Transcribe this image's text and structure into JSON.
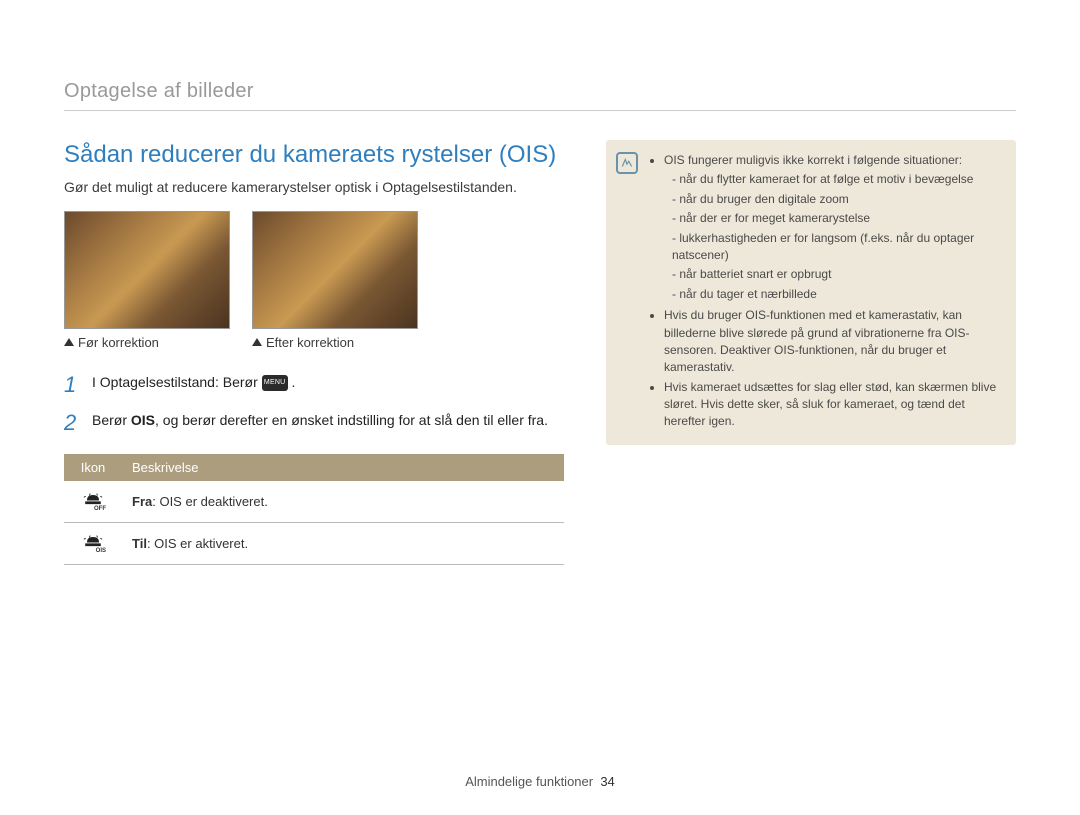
{
  "breadcrumb": "Optagelse af billeder",
  "title": "Sådan reducerer du kameraets rystelser (OIS)",
  "intro": "Gør det muligt at reducere kamerarystelser optisk i Optagelsestilstanden.",
  "samples": {
    "before": "Før korrektion",
    "after": "Efter korrektion"
  },
  "steps": {
    "s1": {
      "num": "1",
      "text": "I Optagelsestilstand: Berør ",
      "menu": "MENU",
      "tail": "."
    },
    "s2": {
      "num": "2",
      "prefix": "Berør ",
      "bold": "OIS",
      "suffix": ", og berør derefter en ønsket indstilling for at slå den til eller fra."
    }
  },
  "table": {
    "head_icon": "Ikon",
    "head_desc": "Beskrivelse",
    "rows": {
      "off": {
        "bold": "Fra",
        "desc": ": OIS er deaktiveret.",
        "sub": "OFF"
      },
      "on": {
        "bold": "Til",
        "desc": ": OIS er aktiveret.",
        "sub": "OIS"
      }
    }
  },
  "note": {
    "head": "OIS fungerer muligvis ikke korrekt i følgende situationer:",
    "sub": {
      "a": "når du flytter kameraet for at følge et motiv i bevægelse",
      "b": "når du bruger den digitale zoom",
      "c": "når der er for meget kamerarystelse",
      "d": "lukkerhastigheden er for langsom (f.eks. når du optager natscener)",
      "e": "når batteriet snart er opbrugt",
      "f": "når du tager et nærbillede"
    },
    "b2": "Hvis du bruger OIS-funktionen med et kamerastativ, kan billederne blive slørede på grund af vibrationerne fra OIS-sensoren. Deaktiver OIS-funktionen, når du bruger et kamerastativ.",
    "b3": "Hvis kameraet udsættes for slag eller stød, kan skærmen blive sløret. Hvis dette sker, så sluk for kameraet, og tænd det herefter igen."
  },
  "footer": {
    "section": "Almindelige funktioner",
    "page": "34"
  }
}
